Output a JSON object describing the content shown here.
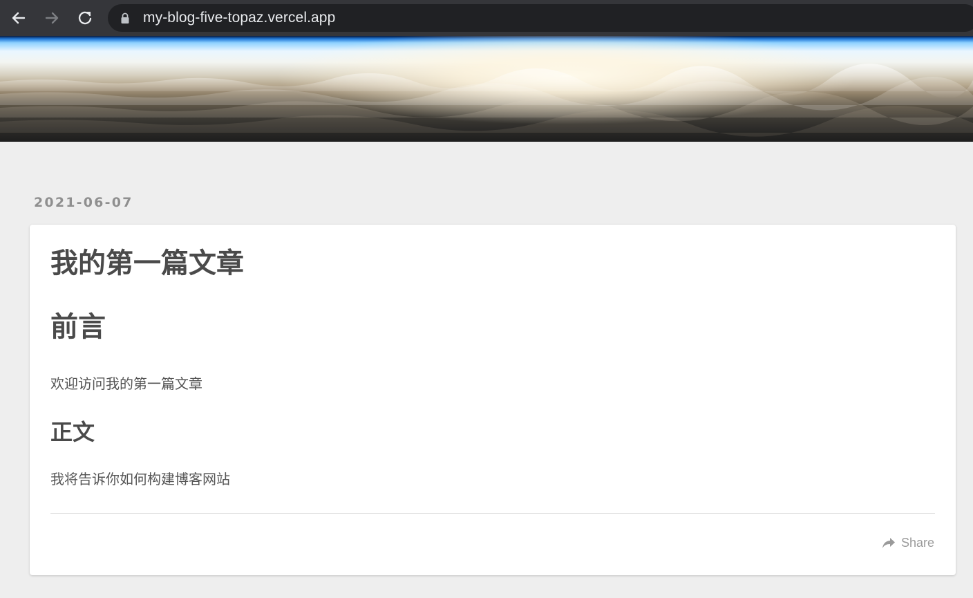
{
  "browser": {
    "url": "my-blog-five-topaz.vercel.app",
    "icons": [
      "back-arrow-icon",
      "forward-arrow-icon",
      "reload-icon",
      "lock-icon"
    ]
  },
  "post": {
    "date": "2021-06-07",
    "title": "我的第一篇文章",
    "heading_intro": "前言",
    "intro_text": "欢迎访问我的第一篇文章",
    "heading_body": "正文",
    "body_text": "我将告诉你如何构建博客网站",
    "share_label": "Share"
  },
  "colors": {
    "page_background": "#eeeeee",
    "card_background": "#ffffff",
    "heading_text": "#4a4a4a",
    "date_text": "#8f8f8f",
    "muted_text": "#9a9a9a",
    "browser_chrome": "#35363a"
  }
}
